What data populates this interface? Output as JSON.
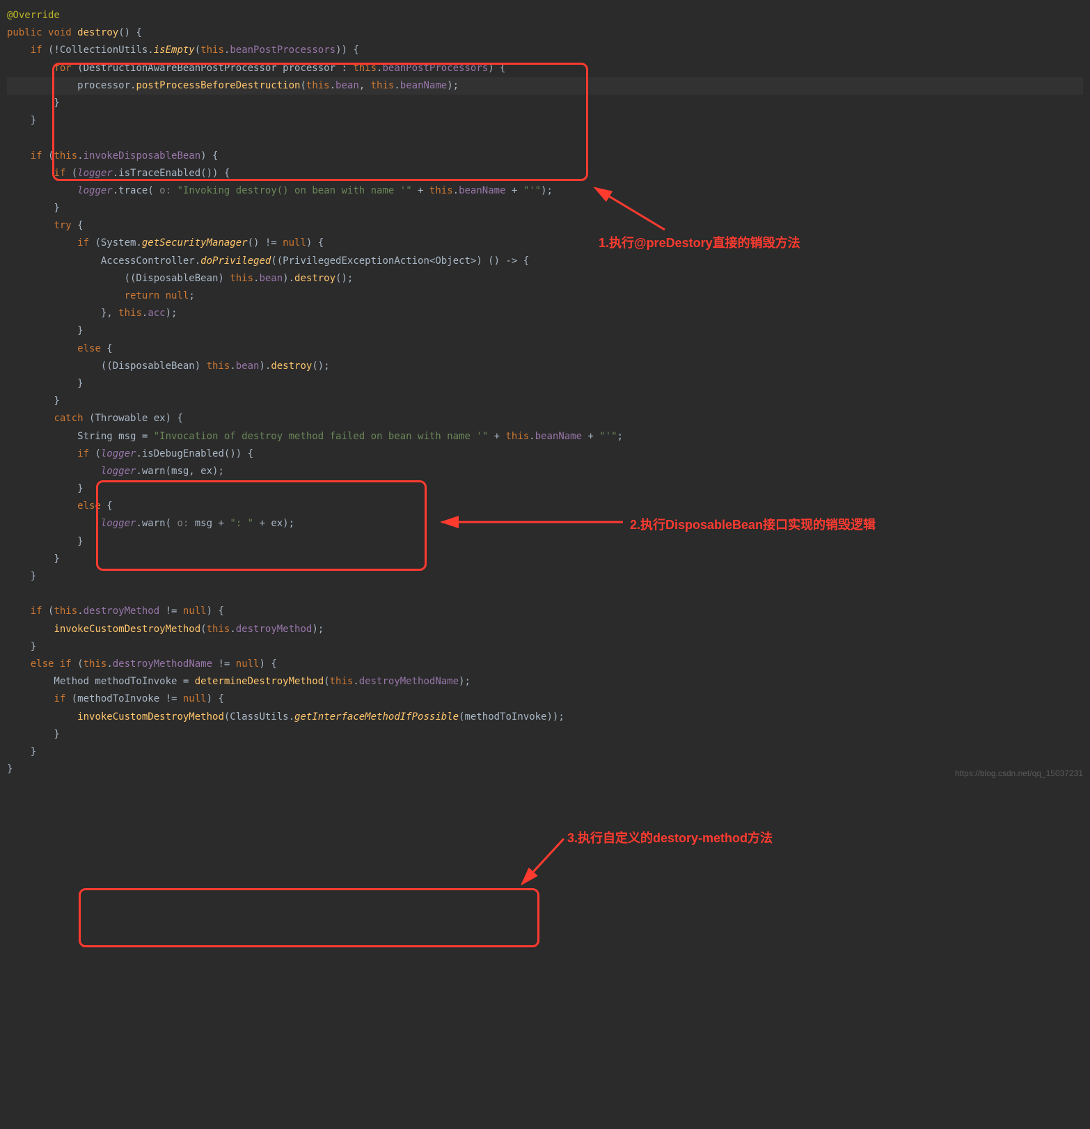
{
  "code": {
    "annotation": "@Override",
    "sig_public": "public",
    "sig_void": "void",
    "sig_name": "destroy",
    "sig_end": "() {",
    "l1a": "    ",
    "l1_if": "if",
    "l1b": " (!CollectionUtils.",
    "l1_isEmpty": "isEmpty",
    "l1c": "(",
    "l1_this": "this",
    "l1d": ".",
    "l1_field": "beanPostProcessors",
    "l1e": ")) {",
    "l2a": "        ",
    "l2_for": "for",
    "l2b": " (DestructionAwareBeanPostProcessor processor : ",
    "l2_this": "this",
    "l2c": ".",
    "l2_field": "beanPostProcessors",
    "l2d": ") {",
    "l3a": "            processor.",
    "l3_method": "postProcessBeforeDestruction",
    "l3b": "(",
    "l3_this1": "this",
    "l3c": ".",
    "l3_field1": "bean",
    "l3d": ", ",
    "l3_this2": "this",
    "l3e": ".",
    "l3_field2": "beanName",
    "l3f": ");",
    "l4": "        }",
    "l5": "    }",
    "blank1": "",
    "l6a": "    ",
    "l6_if": "if",
    "l6b": " (",
    "l6_this": "this",
    "l6c": ".",
    "l6_field": "invokeDisposableBean",
    "l6d": ") {",
    "l7a": "        ",
    "l7_if": "if",
    "l7b": " (",
    "l7_logger": "logger",
    "l7c": ".isTraceEnabled()) {",
    "l8a": "            ",
    "l8_logger": "logger",
    "l8b": ".trace(",
    "l8_hint": " o: ",
    "l8_str1": "\"Invoking destroy() on bean with name '\"",
    "l8c": " + ",
    "l8_this": "this",
    "l8d": ".",
    "l8_field": "beanName",
    "l8e": " + ",
    "l8_str2": "\"'\"",
    "l8f": ");",
    "l9": "        }",
    "l10a": "        ",
    "l10_try": "try",
    "l10b": " {",
    "l11a": "            ",
    "l11_if": "if",
    "l11b": " (System.",
    "l11_method": "getSecurityManager",
    "l11c": "() != ",
    "l11_null": "null",
    "l11d": ") {",
    "l12a": "                AccessController.",
    "l12_method": "doPrivileged",
    "l12b": "((PrivilegedExceptionAction<Object>) () -> {",
    "l13a": "                    ((DisposableBean) ",
    "l13_this": "this",
    "l13b": ".",
    "l13_field": "bean",
    "l13c": ").",
    "l13_method": "destroy",
    "l13d": "();",
    "l14a": "                    ",
    "l14_return": "return ",
    "l14_null": "null",
    "l14b": ";",
    "l15a": "                }, ",
    "l15_this": "this",
    "l15b": ".",
    "l15_field": "acc",
    "l15c": ");",
    "l16": "            }",
    "l17a": "            ",
    "l17_else": "else",
    "l17b": " {",
    "l18a": "                ((DisposableBean) ",
    "l18_this": "this",
    "l18b": ".",
    "l18_field": "bean",
    "l18c": ").",
    "l18_method": "destroy",
    "l18d": "();",
    "l19": "            }",
    "l20": "        }",
    "l21a": "        ",
    "l21_catch": "catch",
    "l21b": " (Throwable ex) {",
    "l22a": "            String msg = ",
    "l22_str1": "\"Invocation of destroy method failed on bean with name '\"",
    "l22b": " + ",
    "l22_this": "this",
    "l22c": ".",
    "l22_field": "beanName",
    "l22d": " + ",
    "l22_str2": "\"'\"",
    "l22e": ";",
    "l23a": "            ",
    "l23_if": "if",
    "l23b": " (",
    "l23_logger": "logger",
    "l23c": ".isDebugEnabled()) {",
    "l24a": "                ",
    "l24_logger": "logger",
    "l24b": ".warn(msg, ex);",
    "l25": "            }",
    "l26a": "            ",
    "l26_else": "else",
    "l26b": " {",
    "l27a": "                ",
    "l27_logger": "logger",
    "l27b": ".warn(",
    "l27_hint": " o: ",
    "l27c": "msg + ",
    "l27_str": "\": \"",
    "l27d": " + ex);",
    "l28": "            }",
    "l29": "        }",
    "l30": "    }",
    "blank2": "",
    "l31a": "    ",
    "l31_if": "if",
    "l31b": " (",
    "l31_this": "this",
    "l31c": ".",
    "l31_field": "destroyMethod",
    "l31d": " != ",
    "l31_null": "null",
    "l31e": ") {",
    "l32a": "        ",
    "l32_method": "invokeCustomDestroyMethod",
    "l32b": "(",
    "l32_this": "this",
    "l32c": ".",
    "l32_field": "destroyMethod",
    "l32d": ");",
    "l33": "    }",
    "l34a": "    ",
    "l34_else": "else if",
    "l34b": " (",
    "l34_this": "this",
    "l34c": ".",
    "l34_field": "destroyMethodName",
    "l34d": " != ",
    "l34_null": "null",
    "l34e": ") {",
    "l35a": "        Method methodToInvoke = ",
    "l35_method": "determineDestroyMethod",
    "l35b": "(",
    "l35_this": "this",
    "l35c": ".",
    "l35_field": "destroyMethodName",
    "l35d": ");",
    "l36a": "        ",
    "l36_if": "if",
    "l36b": " (methodToInvoke != ",
    "l36_null": "null",
    "l36c": ") {",
    "l37a": "            ",
    "l37_method1": "invokeCustomDestroyMethod",
    "l37b": "(ClassUtils.",
    "l37_method2": "getInterfaceMethodIfPossible",
    "l37c": "(methodToInvoke));",
    "l38": "        }",
    "l39": "    }",
    "l40": "}"
  },
  "annotations": {
    "label1": "1.执行@preDestory直接的销毁方法",
    "label2": "2.执行DisposableBean接口实现的销毁逻辑",
    "label3": "3.执行自定义的destory-method方法"
  },
  "watermark": "https://blog.csdn.net/qq_15037231"
}
